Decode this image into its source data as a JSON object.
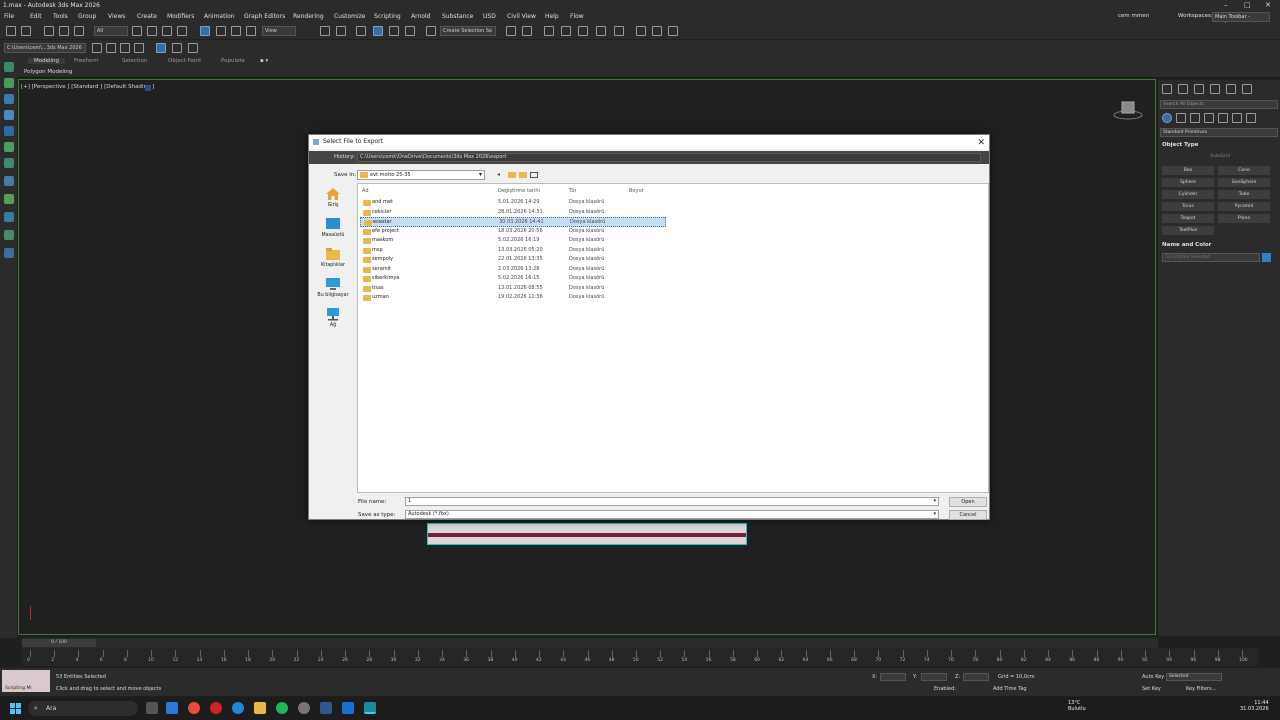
{
  "window": {
    "title": "1.max - Autodesk 3ds Max 2026"
  },
  "menu": {
    "items": [
      "File",
      "Edit",
      "Tools",
      "Group",
      "Views",
      "Create",
      "Modifiers",
      "Animation",
      "Graph Editors",
      "Rendering",
      "Customize",
      "Scripting",
      "Arnold",
      "Substance",
      "USD",
      "Civil View",
      "Help",
      "Flow"
    ],
    "user": "cem mmen",
    "workspaces_label": "Workspaces:",
    "workspace": "Main Toolbar - modern"
  },
  "toolbar": {
    "filter": "All",
    "view": "View",
    "create_selection_set": "Create Selection Se"
  },
  "project_path": "C:\\Users\\cem\\...3ds Max 2026",
  "ribbon": {
    "tabs": [
      "Modeling",
      "Freeform",
      "Selection",
      "Object Paint",
      "Populate"
    ],
    "active_tab": "Modeling",
    "panel": "Polygon Modeling"
  },
  "viewport": {
    "label": "[+] [Perspective ] [Standard ] [Default Shading ]"
  },
  "command_panel": {
    "search": "Search All Objects",
    "category": "Standard Primitives",
    "object_type_title": "Object Type",
    "autogrid": "AutoGrid",
    "buttons": [
      "Box",
      "Cone",
      "Sphere",
      "GeoSphere",
      "Cylinder",
      "Tube",
      "Torus",
      "Pyramid",
      "Teapot",
      "Plane",
      "TextPlus"
    ],
    "name_color_title": "Name and Color",
    "name_value": "53 Entities Selected",
    "color": "#2f7fd0"
  },
  "dialog": {
    "title": "Select File to Export",
    "history_label": "History:",
    "history_value": "C:\\Users\\cemk\\OneDrive\\Documents\\3ds Max 2026\\export",
    "save_in_label": "Save in:",
    "save_in_value": "evt motto 25-35",
    "places": [
      "Giriş",
      "Masaüstü",
      "Kitaplıklar",
      "Bu bilgisayar",
      "Ağ"
    ],
    "columns": [
      "Ad",
      "Değiştirme tarihi",
      "Tür",
      "Boyut"
    ],
    "files": [
      {
        "name": "and met",
        "date": "5.01.2026 14:29",
        "type": "Dosya klasörü"
      },
      {
        "name": "cekicler",
        "date": "28.01.2026 14:31",
        "type": "Dosya klasörü"
      },
      {
        "name": "ecestar",
        "date": "30.03.2026 14:41",
        "type": "Dosya klasörü",
        "selected": true
      },
      {
        "name": "efe project",
        "date": "18.03.2026 20:56",
        "type": "Dosya klasörü"
      },
      {
        "name": "maskom",
        "date": "5.02.2026 16:19",
        "type": "Dosya klasörü"
      },
      {
        "name": "msp",
        "date": "13.03.2026 05:20",
        "type": "Dosya klasörü"
      },
      {
        "name": "sempoly",
        "date": "22.01.2026 13:35",
        "type": "Dosya klasörü"
      },
      {
        "name": "seramit",
        "date": "2.03.2026 13:28",
        "type": "Dosya klasörü"
      },
      {
        "name": "siberkimya",
        "date": "5.02.2026 16:15",
        "type": "Dosya klasörü"
      },
      {
        "name": "tisas",
        "date": "13.01.2026 08:55",
        "type": "Dosya klasörü"
      },
      {
        "name": "uzman",
        "date": "19.02.2026 11:36",
        "type": "Dosya klasörü"
      }
    ],
    "file_name_label": "File name:",
    "file_name_value": "1",
    "save_type_label": "Save as type:",
    "save_type_value": "Autodesk (*.fbx)",
    "open_button": "Open",
    "cancel_button": "Cancel"
  },
  "timeline": {
    "slider": "0 / 100",
    "ticks": [
      "0",
      "2",
      "4",
      "6",
      "8",
      "10",
      "12",
      "14",
      "16",
      "18",
      "20",
      "22",
      "24",
      "26",
      "28",
      "30",
      "32",
      "34",
      "36",
      "38",
      "40",
      "42",
      "44",
      "46",
      "48",
      "50",
      "52",
      "54",
      "56",
      "58",
      "60",
      "62",
      "64",
      "66",
      "68",
      "70",
      "72",
      "74",
      "76",
      "78",
      "80",
      "82",
      "84",
      "86",
      "88",
      "90",
      "92",
      "94",
      "96",
      "98",
      "100"
    ]
  },
  "status": {
    "maxscript": "Scripting Mi",
    "selected": "53 Entities Selected",
    "prompt": "Click and drag to select and move objects",
    "x_label": "X:",
    "y_label": "Y:",
    "z_label": "Z:",
    "grid": "Grid = 10,0cm",
    "enabled": "Enabled:",
    "add_time_tag": "Add Time Tag",
    "auto_key": "Auto Key",
    "set_key": "Set Key",
    "selected_drop": "Selected",
    "key_filters": "Key Filters..."
  },
  "taskbar": {
    "search": "Ara",
    "weather_temp": "13°C",
    "weather_desc": "Bulutlu",
    "time": "11:44",
    "date": "31.03.2026"
  }
}
